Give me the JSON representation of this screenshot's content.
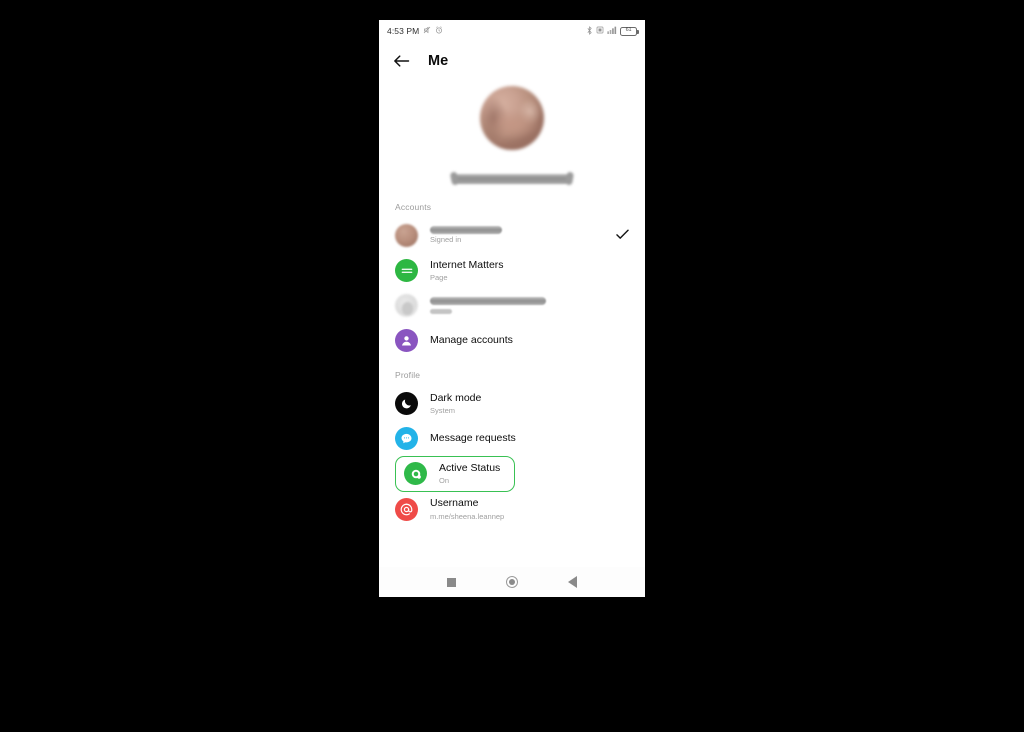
{
  "device": {
    "status_bar": {
      "time": "4:53 PM",
      "battery_level": "61",
      "icons": [
        "mute-icon",
        "alarm-icon",
        "bluetooth-icon",
        "sim-card-icon",
        "signal-bars-icon",
        "battery-icon"
      ]
    },
    "nav_bar": {
      "recents_label": "recents-square-icon",
      "home_label": "home-circle-icon",
      "back_label": "back-triangle-icon"
    }
  },
  "header": {
    "back_icon": "back-arrow-icon",
    "title": "Me"
  },
  "profile_header": {
    "avatar": "user-profile-photo",
    "name": "",
    "name_redacted": true
  },
  "sections": [
    {
      "label": "Accounts",
      "rows": [
        {
          "title": "",
          "redacted_title": true,
          "subtitle": "Signed in",
          "icon": "account-avatar",
          "icon_color": "#b98f7d",
          "checked": true,
          "check_icon": "checkmark-icon"
        },
        {
          "title": "Internet Matters",
          "subtitle": "Page",
          "icon": "page-avatar-green",
          "icon_color": "#2db742",
          "checked": false
        },
        {
          "title": "",
          "redacted_title": true,
          "subtitle": "Page",
          "subtitle_redacted": true,
          "icon": "page-avatar-faded",
          "icon_color": "#dcdcdc",
          "checked": false
        },
        {
          "title": "Manage accounts",
          "subtitle": "",
          "icon": "manage-accounts-person-icon",
          "icon_color": "#8a55c0",
          "checked": false
        }
      ]
    },
    {
      "label": "Profile",
      "rows": [
        {
          "title": "Dark mode",
          "subtitle": "System",
          "icon": "moon-icon",
          "icon_color": "#0a0a0a",
          "highlighted": false
        },
        {
          "title": "Message requests",
          "subtitle": "",
          "icon": "chat-bubble-icon",
          "icon_color": "#23b3e8",
          "highlighted": false
        },
        {
          "title": "Active Status",
          "subtitle": "On",
          "icon": "active-status-icon",
          "icon_color": "#2fb949",
          "highlighted": true
        },
        {
          "title": "Username",
          "subtitle": "m.me/sheena.leannep",
          "icon": "at-sign-icon",
          "icon_color": "#ef4b48",
          "highlighted": false
        }
      ]
    }
  ],
  "colors": {
    "highlight_outline": "#39c153",
    "background": "#000000",
    "phone_background": "#ffffff",
    "primary_text": "#0d0d0d",
    "secondary_text": "#a0a0a0"
  }
}
